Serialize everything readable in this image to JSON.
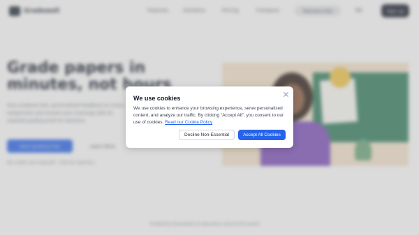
{
  "background": {
    "nav": {
      "brand": "Gradewell",
      "links": [
        "Features",
        "Solutions",
        "Pricing",
        "Company"
      ],
      "pill": "Teachers Edu",
      "lang": "EN",
      "cta": "Sign up"
    },
    "hero": {
      "title": "Grade papers in minutes, not hours",
      "subtitle": "Give students fast, personalized feedback on every assignment and reclaim your evenings with AI-assisted grading built for teachers.",
      "primary_button": "Start grading free",
      "secondary_button": "Learn More",
      "note": "No credit card required · Free for teachers"
    },
    "footer_note": "Trusted by thousands of educators around the world"
  },
  "cookie_modal": {
    "title": "We use cookies",
    "close_icon": "close-icon",
    "body": "We use cookies to enhance your browsing experience, serve personalized content, and analyze our traffic. By clicking \"Accept All\", you consent to our use of cookies.",
    "policy_link": "Read our Cookie Policy",
    "decline_label": "Decline Non-Essential",
    "accept_label": "Accept All Cookies"
  },
  "colors": {
    "accent": "#2563eb",
    "overlay": "#a0a0a0"
  }
}
